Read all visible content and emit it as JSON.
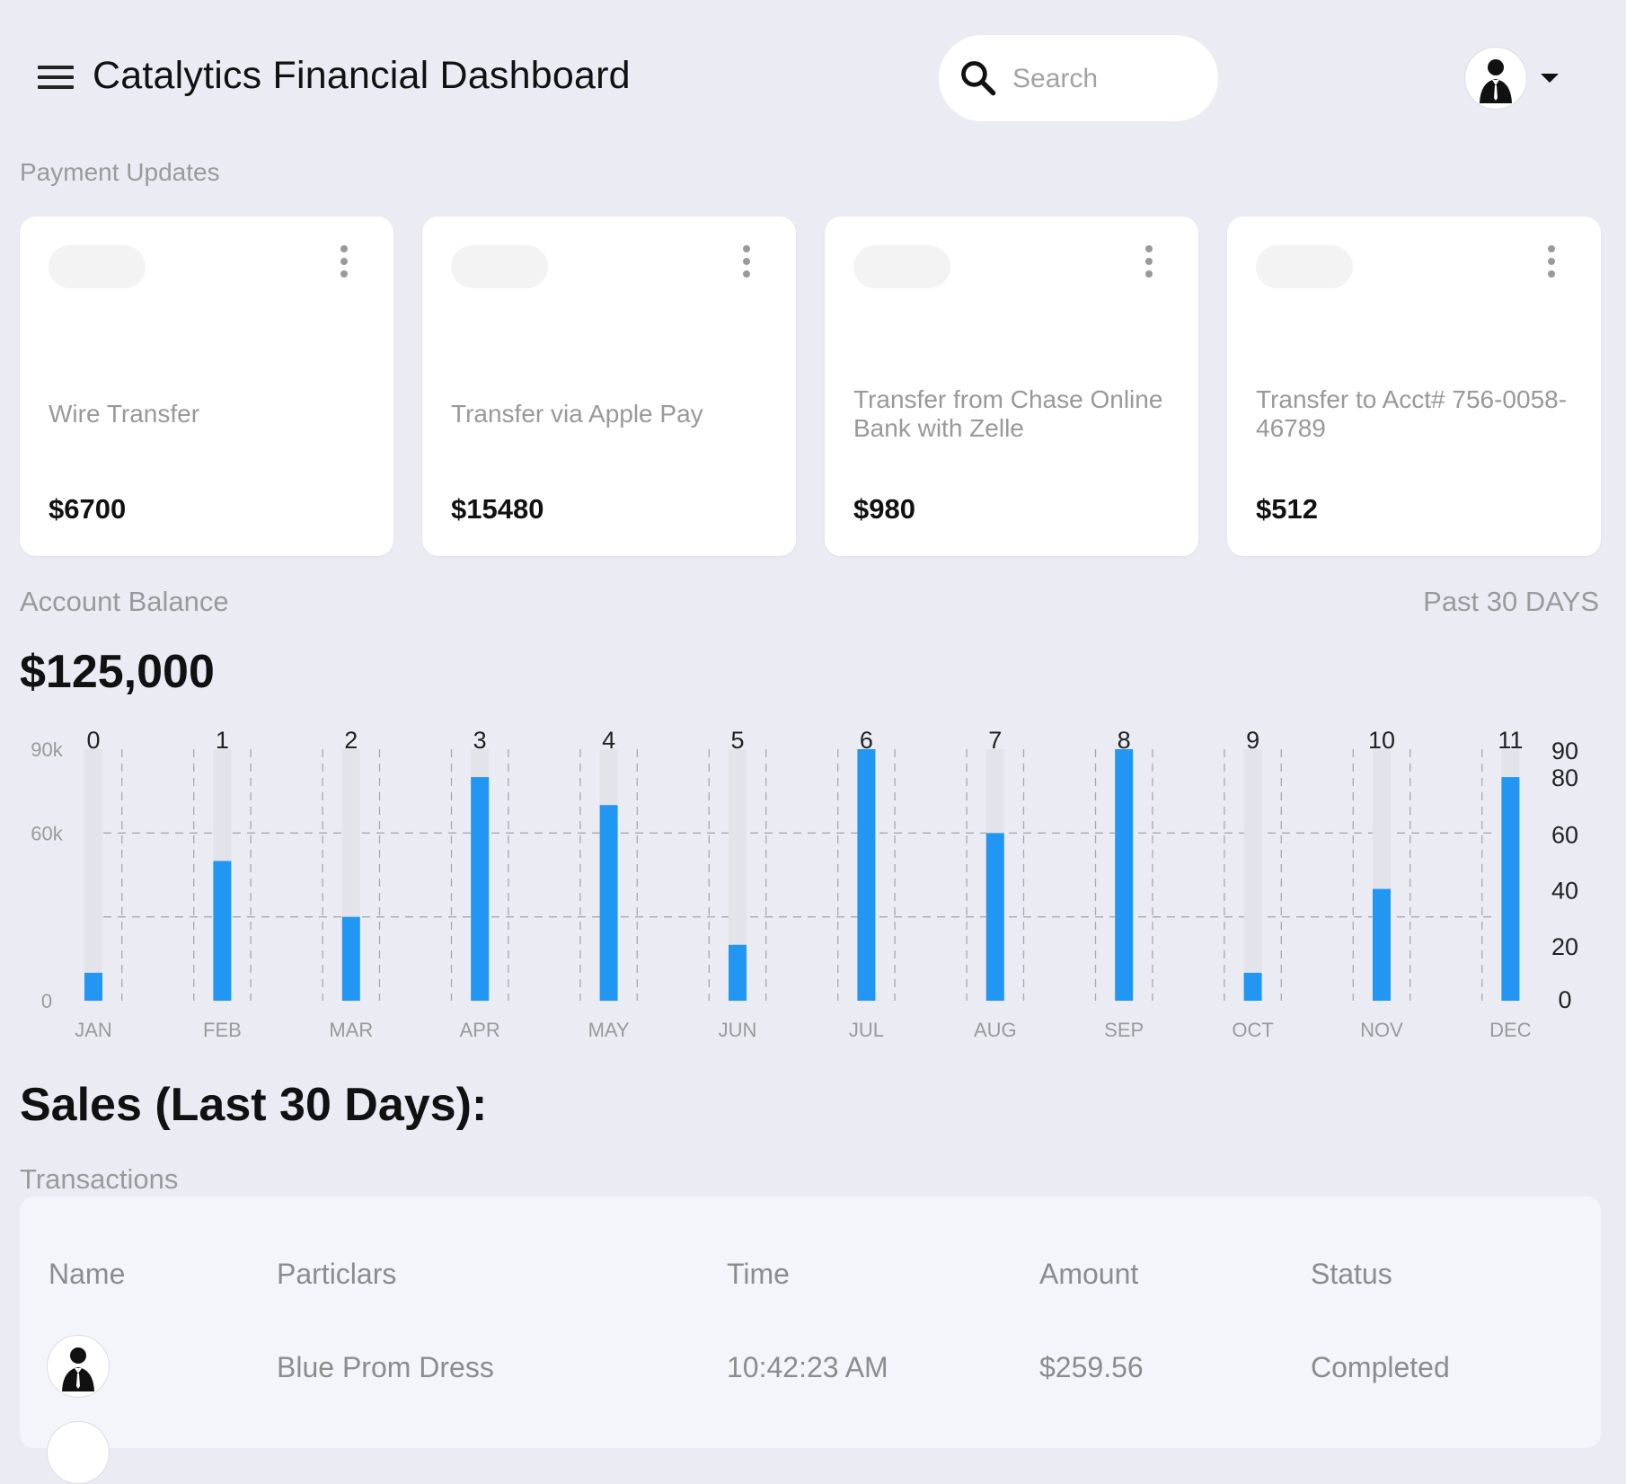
{
  "header": {
    "menu_icon": "hamburger-menu-icon",
    "title": "Catalytics Financial Dashboard",
    "search": {
      "placeholder": "Search",
      "icon": "search-icon"
    },
    "user_menu": {
      "avatar_icon": "user-avatar-icon",
      "caret_icon": "caret-down-icon"
    }
  },
  "payment_updates": {
    "label": "Payment Updates",
    "cards": [
      {
        "description": "Wire Transfer",
        "amount": "$6700"
      },
      {
        "description": "Transfer via Apple Pay",
        "amount": "$15480"
      },
      {
        "description": "Transfer from Chase Online Bank with Zelle",
        "amount": "$980"
      },
      {
        "description": "Transfer to Acct# 756-0058-46789",
        "amount": "$512"
      }
    ]
  },
  "account_balance": {
    "label": "Account Balance",
    "period": "Past 30 DAYS",
    "value": "$125,000"
  },
  "chart_data": {
    "type": "bar",
    "categories": [
      "JAN",
      "FEB",
      "MAR",
      "APR",
      "MAY",
      "JUN",
      "JUL",
      "AUG",
      "SEP",
      "OCT",
      "NOV",
      "DEC"
    ],
    "bar_labels": [
      "0",
      "1",
      "2",
      "3",
      "4",
      "5",
      "6",
      "7",
      "8",
      "9",
      "10",
      "11"
    ],
    "values": [
      10,
      50,
      30,
      80,
      70,
      20,
      90,
      60,
      90,
      10,
      40,
      80
    ],
    "ylim": [
      0,
      90
    ],
    "left_axis_ticks": [
      "90k",
      "60k",
      "0"
    ],
    "right_axis_ticks": [
      "90",
      "80",
      "60",
      "40",
      "20",
      "0"
    ],
    "grid": true,
    "colors": {
      "bar": "#2196f3",
      "track": "#e3e3ea",
      "grid": "#a8a8b0"
    }
  },
  "sales": {
    "title": "Sales (Last 30 Days):",
    "transactions_label": "Transactions",
    "columns": [
      "Name",
      "Particlars",
      "Time",
      "Amount",
      "Status"
    ],
    "rows": [
      {
        "avatar_icon": "user-avatar-icon",
        "particulars": "Blue Prom Dress",
        "time": "10:42:23 AM",
        "amount": "$259.56",
        "status": "Completed"
      }
    ]
  },
  "colors": {
    "background": "#ebebf4",
    "accent": "#2196f3",
    "card": "#ffffff"
  }
}
